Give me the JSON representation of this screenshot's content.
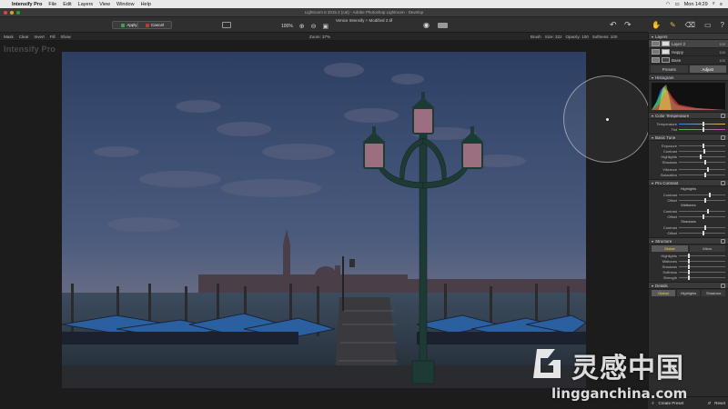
{
  "menubar": {
    "app": "Intensify Pro",
    "items": [
      "File",
      "Edit",
      "Layers",
      "View",
      "Window",
      "Help"
    ],
    "clock": "Mon 14:29"
  },
  "window": {
    "title": "Lightroom 6 2015.2 (cat) - Adobe Photoshop Lightroom - Develop",
    "doc_title": "Venice Intensify + Modified 2.tif"
  },
  "toolbar": {
    "apply_label": "Apply",
    "cancel_label": "Cancel",
    "zoom": "100%"
  },
  "options_bar": {
    "left_items": [
      "Mask",
      "Clear",
      "Invert",
      "Fill",
      "Show"
    ],
    "zoom_label": "Zoom: 37%",
    "brush_items": [
      "Brush",
      "Size: 322",
      "Opacity: 100",
      "Softness: 100"
    ]
  },
  "canvas": {
    "app_watermark": "Intensify Pro"
  },
  "panel": {
    "layers_title": "Layers",
    "layers": [
      {
        "name": "Layer 2",
        "opacity": "100"
      },
      {
        "name": "Happy",
        "opacity": "100"
      },
      {
        "name": "Base",
        "opacity": "100"
      }
    ],
    "tabs": [
      "Presets",
      "Adjust"
    ],
    "sections": {
      "histogram": "Histogram",
      "color_temperature": "Color Temperature",
      "basic_tune": "Basic Tune",
      "pro_contrast": "Pro Contrast",
      "structure": "Structure",
      "details": "Details"
    },
    "color_temp_sliders": [
      "Temperature",
      "Tint"
    ],
    "basic_sliders": [
      "Exposure",
      "Contrast",
      "Highlights",
      "Shadows",
      "Vibrance",
      "Saturation"
    ],
    "pro_contrast": {
      "highlights_label": "Highlights",
      "midtones_label": "Midtones",
      "shadows_label": "Shadows",
      "h_sliders": [
        "Contrast",
        "Offset"
      ],
      "m_sliders": [
        "Contrast",
        "Offset"
      ],
      "s_sliders": [
        "Contrast",
        "Offset"
      ]
    },
    "structure_tabs": [
      "Global",
      "Micro"
    ],
    "structure_sliders": [
      "Highlights",
      "Midtones",
      "Shadows",
      "Softness",
      "Strength"
    ],
    "details_tabs": [
      "Global",
      "Highlights",
      "Shadows"
    ],
    "bottom": {
      "create_preset": "Create Preset",
      "reset": "Reset"
    }
  },
  "site_watermark": {
    "cn_text": "灵感中国",
    "url": "lingganchina.com"
  }
}
